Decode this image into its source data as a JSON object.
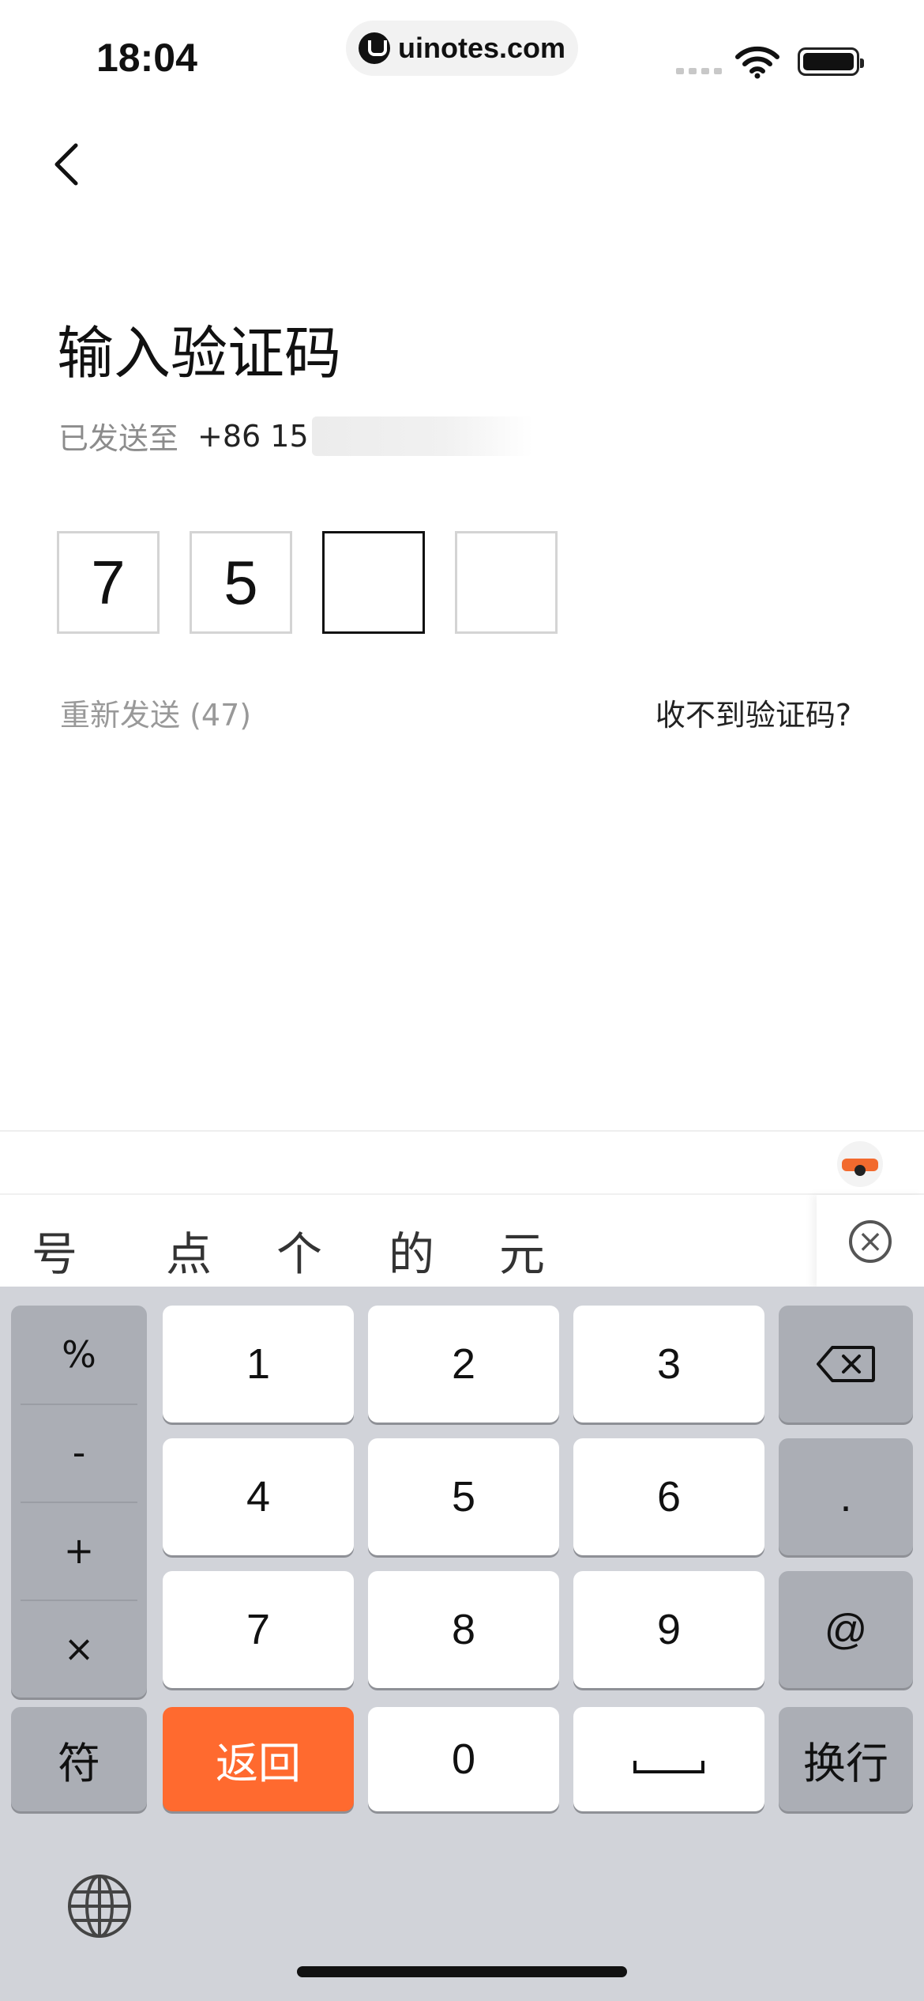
{
  "status_bar": {
    "time": "18:04",
    "url": "uinotes.com"
  },
  "header": {
    "title": "输入验证码",
    "sent_label": "已发送至",
    "phone_prefix": "+86  15"
  },
  "code": {
    "digits": [
      "7",
      "5",
      "",
      ""
    ],
    "active_index": 2
  },
  "resend": {
    "label": "重新发送 (47)"
  },
  "help_link": "收不到验证码?",
  "candidates": [
    "号",
    "点",
    "个",
    "的",
    "元"
  ],
  "keyboard": {
    "symbols": [
      "%",
      "-",
      "+",
      "×"
    ],
    "digits": [
      "1",
      "2",
      "3",
      "4",
      "5",
      "6",
      "7",
      "8",
      "9",
      "0"
    ],
    "dot": ".",
    "at": "@",
    "fu_label": "符",
    "back_label": "返回",
    "enter_label": "换行",
    "accent_color": "#ff6a2f"
  },
  "icons": [
    "back-chevron-icon",
    "wifi-icon",
    "battery-icon",
    "close-circle-icon",
    "backspace-icon",
    "globe-icon",
    "space-icon"
  ]
}
